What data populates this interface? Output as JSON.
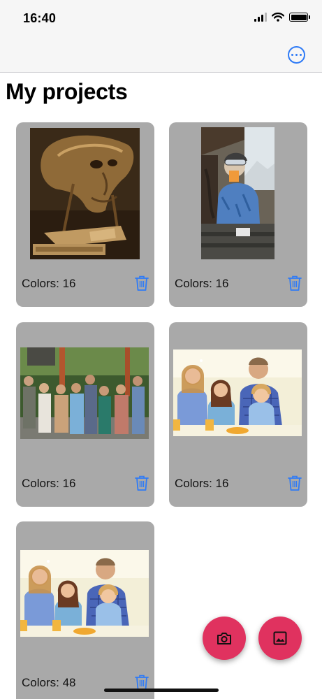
{
  "status_bar": {
    "time": "16:40",
    "icons": [
      "cellular-signal-icon",
      "wifi-icon",
      "battery-icon"
    ]
  },
  "nav_bar": {
    "actions": [
      {
        "icon": "more-ellipsis-icon"
      }
    ]
  },
  "page": {
    "title": "My projects"
  },
  "projects": [
    {
      "colors_label": "Colors: 16",
      "image": "surreal-self-portrait-painting",
      "delete_icon": "trash-icon"
    },
    {
      "colors_label": "Colors: 16",
      "image": "skier-on-terrace",
      "delete_icon": "trash-icon"
    },
    {
      "colors_label": "Colors: 16",
      "image": "group-photo-in-garden",
      "delete_icon": "trash-icon"
    },
    {
      "colors_label": "Colors: 16",
      "image": "family-at-table",
      "delete_icon": "trash-icon"
    },
    {
      "colors_label": "Colors: 48",
      "image": "family-at-table",
      "delete_icon": "trash-icon"
    }
  ],
  "floating_actions": [
    {
      "icon": "camera-icon"
    },
    {
      "icon": "image-gallery-icon"
    }
  ],
  "colors": {
    "accent": "#2f7bf6",
    "fab": "#e0325f",
    "card_background": "#a9a9a9"
  }
}
